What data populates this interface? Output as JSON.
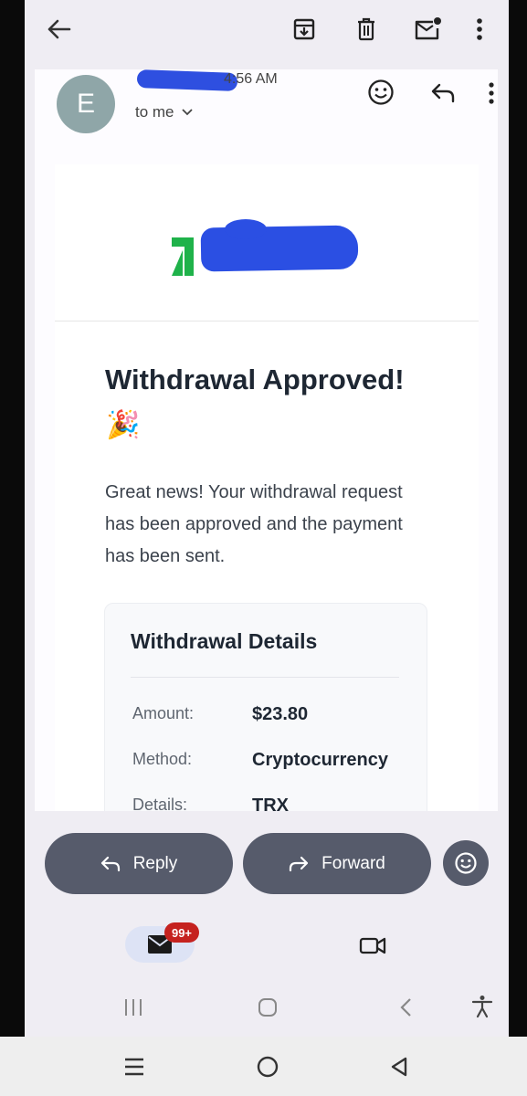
{
  "email": {
    "avatar_letter": "E",
    "time": "4:56 AM",
    "recipient": "to me",
    "headline": "Withdrawal Approved!",
    "party_emoji": "🎉",
    "body": "Great news! Your withdrawal request has been approved and the payment has been sent.",
    "details": {
      "title": "Withdrawal Details",
      "rows": [
        {
          "label": "Amount:",
          "value": "$23.80"
        },
        {
          "label": "Method:",
          "value": "Cryptocurrency"
        },
        {
          "label": "Details:",
          "value": "TRX"
        }
      ]
    }
  },
  "actions": {
    "reply_label": "Reply",
    "forward_label": "Forward"
  },
  "nav": {
    "mail_badge": "99+"
  },
  "colors": {
    "brand_green": "#1fb24a",
    "redaction_blue": "#2b4fe3",
    "action_button": "#565b6b",
    "badge_red": "#c5221f"
  }
}
